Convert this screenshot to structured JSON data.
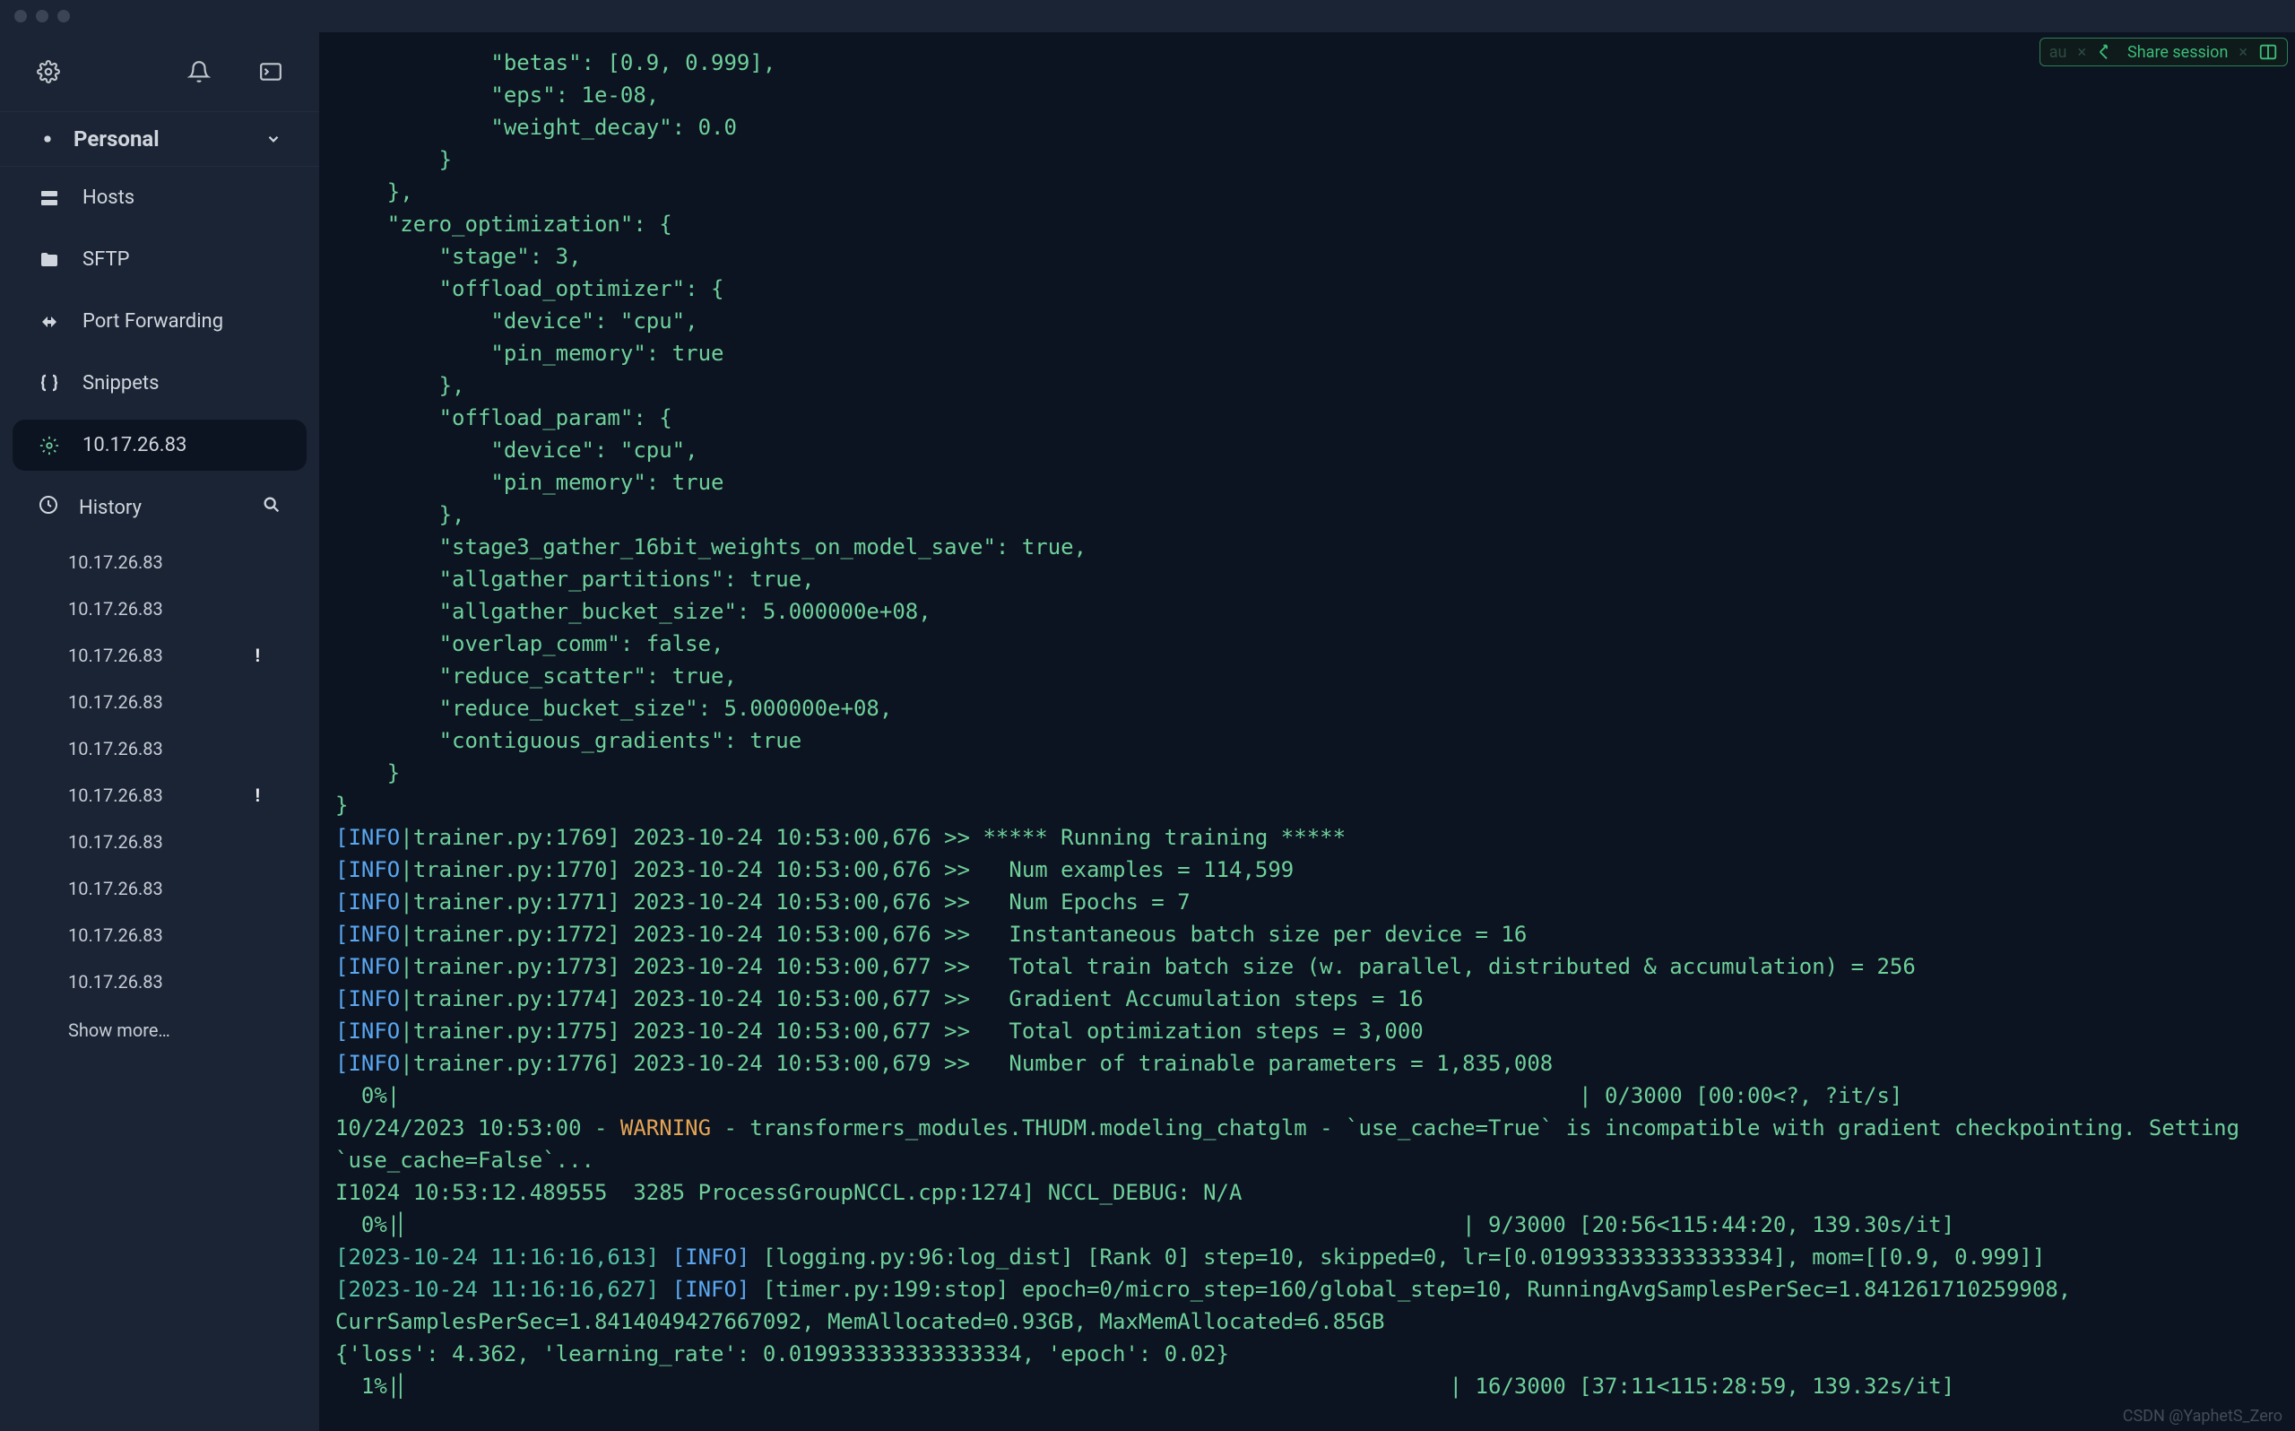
{
  "workspace": {
    "label": "Personal"
  },
  "nav": {
    "hosts": "Hosts",
    "sftp": "SFTP",
    "portfwd": "Port Forwarding",
    "snippets": "Snippets"
  },
  "active_session": "10.17.26.83",
  "history_label": "History",
  "history": [
    {
      "label": "10.17.26.83",
      "alert": false
    },
    {
      "label": "10.17.26.83",
      "alert": false
    },
    {
      "label": "10.17.26.83",
      "alert": true
    },
    {
      "label": "10.17.26.83",
      "alert": false
    },
    {
      "label": "10.17.26.83",
      "alert": false
    },
    {
      "label": "10.17.26.83",
      "alert": true
    },
    {
      "label": "10.17.26.83",
      "alert": false
    },
    {
      "label": "10.17.26.83",
      "alert": false
    },
    {
      "label": "10.17.26.83",
      "alert": false
    },
    {
      "label": "10.17.26.83",
      "alert": false
    }
  ],
  "show_more": "Show more…",
  "toolbar": {
    "au": "au",
    "share": "Share session"
  },
  "watermark": "CSDN @YaphetS_Zero",
  "term": {
    "json": "            \"betas\": [0.9, 0.999],\n            \"eps\": 1e-08,\n            \"weight_decay\": 0.0\n        }\n    },\n    \"zero_optimization\": {\n        \"stage\": 3,\n        \"offload_optimizer\": {\n            \"device\": \"cpu\",\n            \"pin_memory\": true\n        },\n        \"offload_param\": {\n            \"device\": \"cpu\",\n            \"pin_memory\": true\n        },\n        \"stage3_gather_16bit_weights_on_model_save\": true,\n        \"allgather_partitions\": true,\n        \"allgather_bucket_size\": 5.000000e+08,\n        \"overlap_comm\": false,\n        \"reduce_scatter\": true,\n        \"reduce_bucket_size\": 5.000000e+08,\n        \"contiguous_gradients\": true\n    }\n}",
    "info_tag": "[INFO",
    "l1a": "|trainer.py:1769] 2023-10-24 10:53:00,676 >> ***** Running training *****",
    "l2a": "|trainer.py:1770] 2023-10-24 10:53:00,676 >>   Num examples = 114,599",
    "l3a": "|trainer.py:1771] 2023-10-24 10:53:00,676 >>   Num Epochs = 7",
    "l4a": "|trainer.py:1772] 2023-10-24 10:53:00,676 >>   Instantaneous batch size per device = 16",
    "l5a": "|trainer.py:1773] 2023-10-24 10:53:00,677 >>   Total train batch size (w. parallel, distributed & accumulation) = 256",
    "l6a": "|trainer.py:1774] 2023-10-24 10:53:00,677 >>   Gradient Accumulation steps = 16",
    "l7a": "|trainer.py:1775] 2023-10-24 10:53:00,677 >>   Total optimization steps = 3,000",
    "l8a": "|trainer.py:1776] 2023-10-24 10:53:00,679 >>   Number of trainable parameters = 1,835,008",
    "p0": "  0%|                                                                                           | 0/3000 [00:00<?, ?it/s]",
    "warn_pre": "10/24/2023 10:53:00 - ",
    "warn_tag": "WARNING",
    "warn_post": " - transformers_modules.THUDM.modeling_chatglm - `use_cache=True` is incompatible with gradient checkpointing. Setting `use_cache=False`...",
    "nccl": "I1024 10:53:12.489555  3285 ProcessGroupNCCL.cpp:1274] NCCL_DEBUG: N/A",
    "p1": "  0%|▏                                                                                 | 9/3000 [20:56<115:44:20, 139.30s/it]",
    "ts1": "[2023-10-24 11:16:16,613]",
    "info2": "[INFO]",
    "log1": " [logging.py:96:log_dist] [Rank 0] step=10, skipped=0, lr=[0.019933333333333334], mom=[[0.9, 0.999]]",
    "ts2": "[2023-10-24 11:16:16,627]",
    "log2": " [timer.py:199:stop] epoch=0/micro_step=160/global_step=10, RunningAvgSamplesPerSec=1.841261710259908, CurrSamplesPerSec=1.8414049427667092, MemAllocated=0.93GB, MaxMemAllocated=6.85GB",
    "loss": "{'loss': 4.362, 'learning_rate': 0.019933333333333334, 'epoch': 0.02}",
    "p2": "  1%|▏                                                                                | 16/3000 [37:11<115:28:59, 139.32s/it]"
  }
}
